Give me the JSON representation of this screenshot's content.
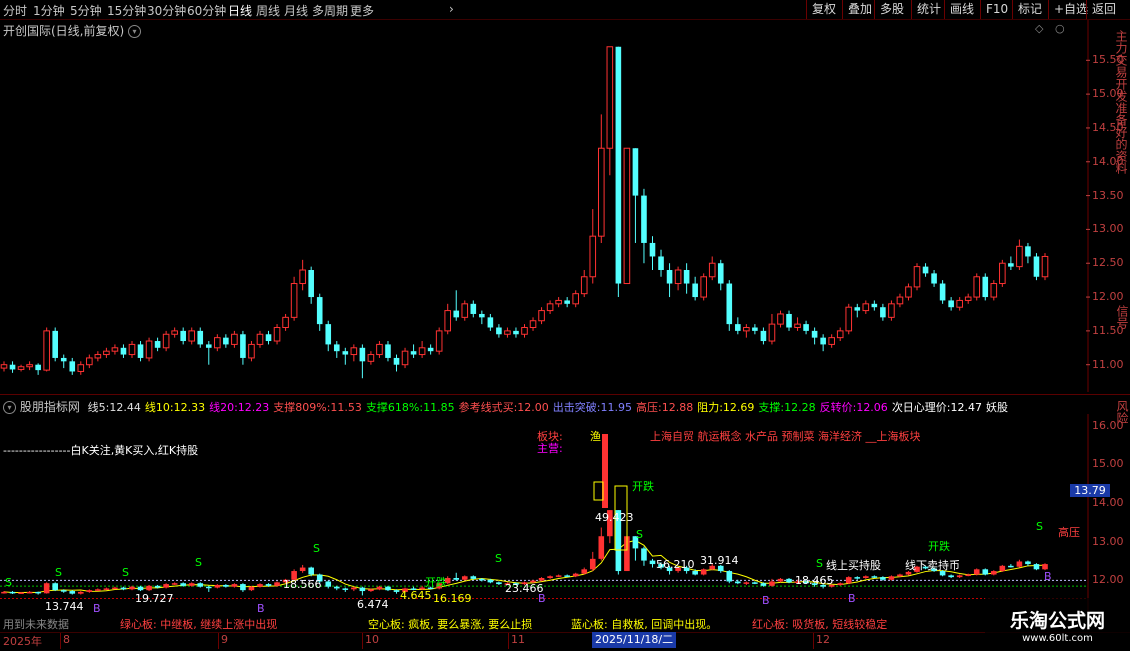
{
  "toolbar": {
    "periods": [
      "分时",
      "1分钟",
      "5分钟",
      "15分钟",
      "30分钟",
      "60分钟",
      "日线",
      "周线",
      "月线",
      "多周期",
      "更多"
    ],
    "active_period": "日线",
    "more_arrow": "›",
    "right_buttons": [
      "复权",
      "叠加",
      "多股",
      "统计",
      "画线",
      "F10",
      "标记",
      "+自选",
      "返回"
    ]
  },
  "main_panel": {
    "title": "开创国际(日线,前复权)",
    "dropdown_icon": "chevron-down-icon",
    "price_ticks": [
      "15.50",
      "15.00",
      "14.50",
      "14.00",
      "13.50",
      "13.00",
      "12.50",
      "12.00",
      "11.50",
      "11.00"
    ]
  },
  "right_side_text": {
    "main": "主力交易开发准备好的资料",
    "main_tail": "信号",
    "bottom": "风险"
  },
  "indicator_panel": {
    "name": "股朋指标网",
    "values": [
      {
        "label": "线5:",
        "value": "12.44",
        "color": "#e0e0e0"
      },
      {
        "label": "线10:",
        "value": "12.33",
        "color": "#ffff00"
      },
      {
        "label": "线20:",
        "value": "12.23",
        "color": "#ff00ff"
      },
      {
        "label": "支撑809%:",
        "value": "11.53",
        "color": "#ff5050"
      },
      {
        "label": "支撑618%:",
        "value": "11.85",
        "color": "#00ff00"
      },
      {
        "label": "参考线式买:",
        "value": "12.00",
        "color": "#ff5050"
      },
      {
        "label": "出击突破:",
        "value": "11.95",
        "color": "#8080ff"
      },
      {
        "label": "高压:",
        "value": "12.88",
        "color": "#ff5050"
      },
      {
        "label": "阻力:",
        "value": "12.69",
        "color": "#ffff00"
      },
      {
        "label": "支撑:",
        "value": "12.28",
        "color": "#00ff00"
      },
      {
        "label": "反转价:",
        "value": "12.06",
        "color": "#ff00ff"
      },
      {
        "label": "次日心理价:",
        "value": "12.47",
        "color": "#ffffff"
      },
      {
        "label": "妖股",
        "value": "",
        "color": "#ffffff"
      }
    ],
    "price_ticks": [
      "16.00",
      "15.00",
      "14.00",
      "13.00",
      "12.00"
    ],
    "current_price_tag": "13.79",
    "legend_note": "-----------------白K关注,黄K买入,红K持股",
    "board_label": "板块:",
    "main_label": "主营:",
    "board_tag": "渔",
    "board_concepts": "上海自贸 航运概念 水产品 预制菜 海洋经济 __上海板块",
    "open_signal_1": "开跌",
    "open_signal_2": "开跌",
    "open_signal_3": "开跌",
    "line_buy": "线上买持股",
    "line_sell": "线下卖持币",
    "high_label": "高压",
    "price_annotations": [
      "13.744",
      "19.727",
      "18.566",
      "6.474",
      "4.645",
      "16.169",
      "23.466",
      "49.423",
      "56.210",
      "31.914",
      "18.465"
    ],
    "footer_notes": [
      {
        "text": "绿心板: 中继板, 继续上涨中出现",
        "color": "#ff4040"
      },
      {
        "text": "空心板: 疯板, 要么暴涨, 要么止损",
        "color": "#ffff00"
      },
      {
        "text": "蓝心板: 自救板, 回调中出现。",
        "color": "#ffff00"
      },
      {
        "text": "红心板: 吸货板, 短线较稳定",
        "color": "#ff4040"
      }
    ],
    "left_footer": "用到未来数据"
  },
  "date_axis": {
    "year": "2025年",
    "months": [
      "8",
      "9",
      "10",
      "11",
      "12"
    ],
    "cursor_date": "2025/11/18/二"
  },
  "watermark": {
    "site": "乐淘公式网",
    "url": "www.60lt.com"
  },
  "chart_data": {
    "type": "candlestick",
    "title": "开创国际(日线,前复权)",
    "ylim": [
      10.7,
      15.8
    ],
    "up_color": "#ff3232",
    "down_color": "#54ffff",
    "candles": [
      [
        10.95,
        11.0,
        11.05,
        10.9
      ],
      [
        11.0,
        10.93,
        11.05,
        10.88
      ],
      [
        10.93,
        10.97,
        11.0,
        10.9
      ],
      [
        10.97,
        11.0,
        11.05,
        10.92
      ],
      [
        11.0,
        10.92,
        11.02,
        10.85
      ],
      [
        10.92,
        11.5,
        11.55,
        10.9
      ],
      [
        11.5,
        11.1,
        11.55,
        11.05
      ],
      [
        11.1,
        11.05,
        11.15,
        10.95
      ],
      [
        11.05,
        10.9,
        11.1,
        10.85
      ],
      [
        10.9,
        11.0,
        11.05,
        10.85
      ],
      [
        11.0,
        11.1,
        11.15,
        10.95
      ],
      [
        11.1,
        11.15,
        11.2,
        11.05
      ],
      [
        11.15,
        11.2,
        11.25,
        11.1
      ],
      [
        11.2,
        11.25,
        11.3,
        11.15
      ],
      [
        11.25,
        11.15,
        11.3,
        11.1
      ],
      [
        11.15,
        11.3,
        11.35,
        11.1
      ],
      [
        11.3,
        11.1,
        11.35,
        11.05
      ],
      [
        11.1,
        11.35,
        11.4,
        11.05
      ],
      [
        11.35,
        11.25,
        11.4,
        11.2
      ],
      [
        11.25,
        11.45,
        11.5,
        11.2
      ],
      [
        11.45,
        11.5,
        11.55,
        11.4
      ],
      [
        11.5,
        11.35,
        11.55,
        11.3
      ],
      [
        11.35,
        11.5,
        11.55,
        11.3
      ],
      [
        11.5,
        11.3,
        11.55,
        11.25
      ],
      [
        11.3,
        11.25,
        11.35,
        11.0
      ],
      [
        11.25,
        11.4,
        11.45,
        11.2
      ],
      [
        11.4,
        11.3,
        11.45,
        11.25
      ],
      [
        11.3,
        11.45,
        11.5,
        11.25
      ],
      [
        11.45,
        11.1,
        11.5,
        11.0
      ],
      [
        11.1,
        11.3,
        11.35,
        11.05
      ],
      [
        11.3,
        11.45,
        11.5,
        11.25
      ],
      [
        11.45,
        11.35,
        11.5,
        11.3
      ],
      [
        11.35,
        11.55,
        11.6,
        11.3
      ],
      [
        11.55,
        11.7,
        11.75,
        11.5
      ],
      [
        11.7,
        12.2,
        12.3,
        11.65
      ],
      [
        12.2,
        12.4,
        12.55,
        12.1
      ],
      [
        12.4,
        12.0,
        12.45,
        11.9
      ],
      [
        12.0,
        11.6,
        12.05,
        11.5
      ],
      [
        11.6,
        11.3,
        11.65,
        11.2
      ],
      [
        11.3,
        11.2,
        11.35,
        11.1
      ],
      [
        11.2,
        11.15,
        11.25,
        11.0
      ],
      [
        11.15,
        11.25,
        11.3,
        11.05
      ],
      [
        11.25,
        11.05,
        11.3,
        10.8
      ],
      [
        11.05,
        11.15,
        11.2,
        11.0
      ],
      [
        11.15,
        11.3,
        11.35,
        11.1
      ],
      [
        11.3,
        11.1,
        11.35,
        11.05
      ],
      [
        11.1,
        11.0,
        11.15,
        10.9
      ],
      [
        11.0,
        11.2,
        11.25,
        10.95
      ],
      [
        11.2,
        11.15,
        11.3,
        11.1
      ],
      [
        11.15,
        11.25,
        11.35,
        11.1
      ],
      [
        11.25,
        11.2,
        11.3,
        11.15
      ],
      [
        11.2,
        11.5,
        11.55,
        11.15
      ],
      [
        11.5,
        11.8,
        11.9,
        11.45
      ],
      [
        11.8,
        11.7,
        12.1,
        11.65
      ],
      [
        11.7,
        11.9,
        11.95,
        11.65
      ],
      [
        11.9,
        11.75,
        11.95,
        11.7
      ],
      [
        11.75,
        11.7,
        11.8,
        11.6
      ],
      [
        11.7,
        11.55,
        11.75,
        11.5
      ],
      [
        11.55,
        11.45,
        11.6,
        11.4
      ],
      [
        11.45,
        11.5,
        11.55,
        11.4
      ],
      [
        11.5,
        11.45,
        11.55,
        11.4
      ],
      [
        11.45,
        11.55,
        11.6,
        11.4
      ],
      [
        11.55,
        11.65,
        11.7,
        11.5
      ],
      [
        11.65,
        11.8,
        11.85,
        11.6
      ],
      [
        11.8,
        11.9,
        11.95,
        11.75
      ],
      [
        11.9,
        11.95,
        12.0,
        11.85
      ],
      [
        11.95,
        11.9,
        12.0,
        11.85
      ],
      [
        11.9,
        12.05,
        12.1,
        11.85
      ],
      [
        12.05,
        12.3,
        12.4,
        12.0
      ],
      [
        12.3,
        12.9,
        13.3,
        12.2
      ],
      [
        12.9,
        14.2,
        14.7,
        12.8
      ],
      [
        14.2,
        15.7,
        15.7,
        13.8
      ],
      [
        15.7,
        12.2,
        15.7,
        12.0
      ],
      [
        12.2,
        14.2,
        14.2,
        12.2
      ],
      [
        14.2,
        13.5,
        14.2,
        12.8
      ],
      [
        13.5,
        12.8,
        13.6,
        12.5
      ],
      [
        12.8,
        12.6,
        12.9,
        12.4
      ],
      [
        12.6,
        12.4,
        12.7,
        12.3
      ],
      [
        12.4,
        12.2,
        12.5,
        12.0
      ],
      [
        12.2,
        12.4,
        12.45,
        12.1
      ],
      [
        12.4,
        12.2,
        12.5,
        12.05
      ],
      [
        12.2,
        12.0,
        12.3,
        11.95
      ],
      [
        12.0,
        12.3,
        12.35,
        11.95
      ],
      [
        12.3,
        12.5,
        12.6,
        12.25
      ],
      [
        12.5,
        12.2,
        12.55,
        12.1
      ],
      [
        12.2,
        11.6,
        12.25,
        11.5
      ],
      [
        11.6,
        11.5,
        11.7,
        11.45
      ],
      [
        11.5,
        11.55,
        11.6,
        11.4
      ],
      [
        11.55,
        11.5,
        11.6,
        11.45
      ],
      [
        11.5,
        11.35,
        11.55,
        11.3
      ],
      [
        11.35,
        11.6,
        11.75,
        11.3
      ],
      [
        11.6,
        11.75,
        11.8,
        11.55
      ],
      [
        11.75,
        11.55,
        11.8,
        11.5
      ],
      [
        11.55,
        11.6,
        11.7,
        11.5
      ],
      [
        11.6,
        11.5,
        11.65,
        11.45
      ],
      [
        11.5,
        11.4,
        11.55,
        11.3
      ],
      [
        11.4,
        11.3,
        11.45,
        11.2
      ],
      [
        11.3,
        11.4,
        11.45,
        11.25
      ],
      [
        11.4,
        11.5,
        11.55,
        11.35
      ],
      [
        11.5,
        11.85,
        11.9,
        11.45
      ],
      [
        11.85,
        11.8,
        11.9,
        11.7
      ],
      [
        11.8,
        11.9,
        11.95,
        11.75
      ],
      [
        11.9,
        11.85,
        11.95,
        11.8
      ],
      [
        11.85,
        11.7,
        11.9,
        11.65
      ],
      [
        11.7,
        11.9,
        11.95,
        11.65
      ],
      [
        11.9,
        12.0,
        12.05,
        11.85
      ],
      [
        12.0,
        12.15,
        12.2,
        11.95
      ],
      [
        12.15,
        12.45,
        12.5,
        12.1
      ],
      [
        12.45,
        12.35,
        12.5,
        12.3
      ],
      [
        12.35,
        12.2,
        12.4,
        12.15
      ],
      [
        12.2,
        11.95,
        12.25,
        11.9
      ],
      [
        11.95,
        11.85,
        12.0,
        11.8
      ],
      [
        11.85,
        11.95,
        12.0,
        11.8
      ],
      [
        11.95,
        12.0,
        12.05,
        11.9
      ],
      [
        12.0,
        12.3,
        12.35,
        11.95
      ],
      [
        12.3,
        12.0,
        12.35,
        11.95
      ],
      [
        12.0,
        12.2,
        12.25,
        11.95
      ],
      [
        12.2,
        12.5,
        12.55,
        12.15
      ],
      [
        12.5,
        12.45,
        12.6,
        12.4
      ],
      [
        12.45,
        12.75,
        12.85,
        12.4
      ],
      [
        12.75,
        12.6,
        12.8,
        12.5
      ],
      [
        12.6,
        12.3,
        12.65,
        12.25
      ],
      [
        12.3,
        12.6,
        12.65,
        12.25
      ]
    ]
  }
}
